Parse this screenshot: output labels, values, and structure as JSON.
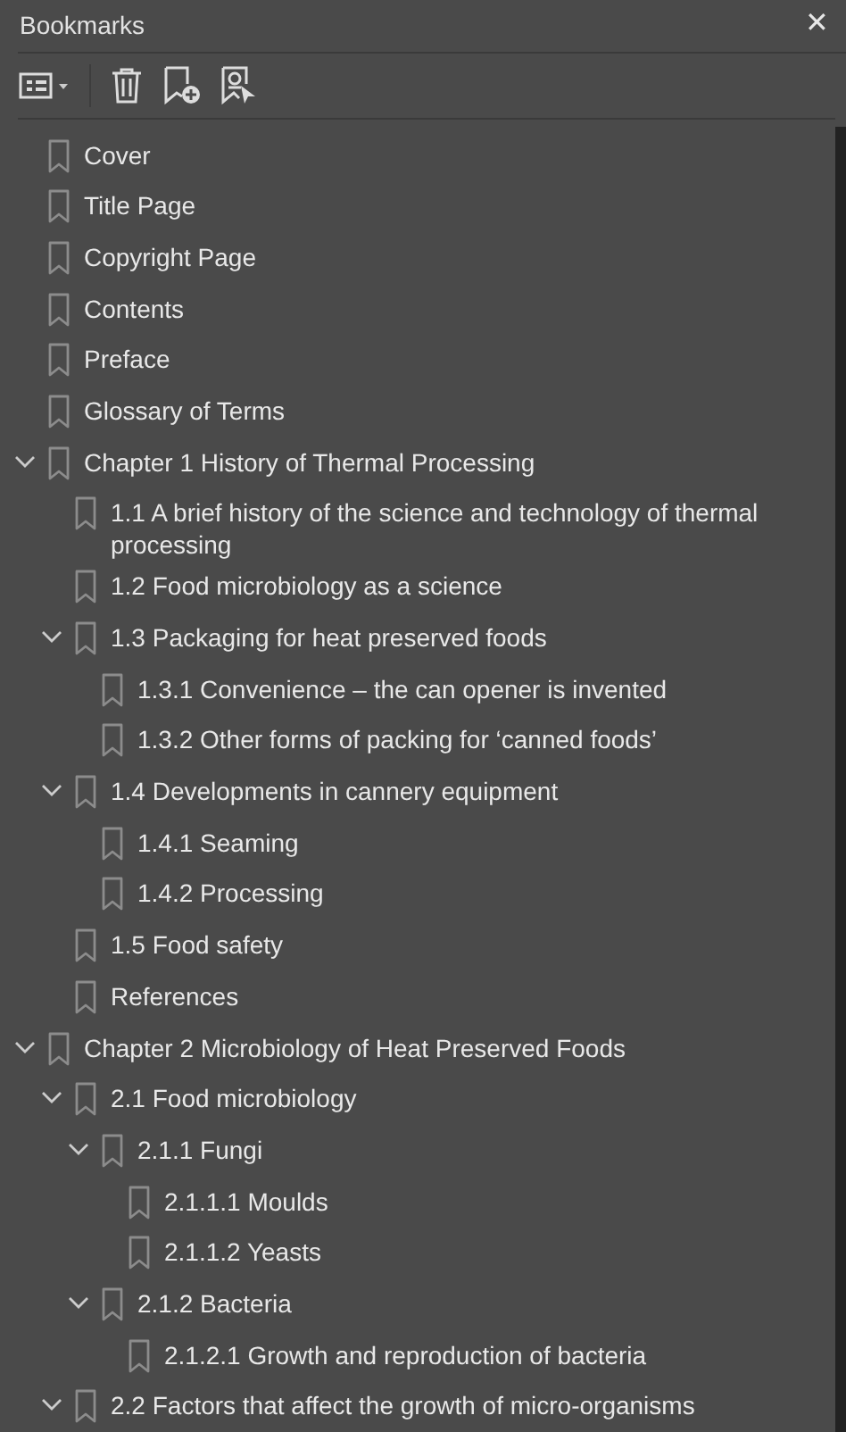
{
  "panel": {
    "title": "Bookmarks",
    "close": "✕"
  },
  "bookmarks": [
    {
      "label": "Cover"
    },
    {
      "label": "Title Page"
    },
    {
      "label": "Copyright Page"
    },
    {
      "label": "Contents"
    },
    {
      "label": "Preface"
    },
    {
      "label": "Glossary of Terms"
    },
    {
      "label": "Chapter 1 History of Thermal Processing",
      "expanded": true,
      "children": [
        {
          "label": "1.1 A brief history of the science and technology of thermal processing"
        },
        {
          "label": "1.2 Food microbiology as a science"
        },
        {
          "label": "1.3 Packaging for heat preserved foods",
          "expanded": true,
          "children": [
            {
              "label": "1.3.1 Convenience – the can opener is invented"
            },
            {
              "label": "1.3.2 Other forms of packing for ‘canned foods’"
            }
          ]
        },
        {
          "label": "1.4 Developments in cannery equipment",
          "expanded": true,
          "children": [
            {
              "label": "1.4.1 Seaming"
            },
            {
              "label": "1.4.2 Processing"
            }
          ]
        },
        {
          "label": "1.5 Food safety"
        },
        {
          "label": "References"
        }
      ]
    },
    {
      "label": "Chapter 2 Microbiology of Heat Preserved Foods",
      "expanded": true,
      "children": [
        {
          "label": "2.1 Food microbiology",
          "expanded": true,
          "children": [
            {
              "label": "2.1.1 Fungi",
              "expanded": true,
              "children": [
                {
                  "label": "2.1.1.1 Moulds"
                },
                {
                  "label": "2.1.1.2 Yeasts"
                }
              ]
            },
            {
              "label": "2.1.2 Bacteria",
              "expanded": true,
              "children": [
                {
                  "label": "2.1.2.1 Growth and reproduction of bacteria"
                }
              ]
            }
          ]
        },
        {
          "label": "2.2 Factors that affect the growth of micro-organisms",
          "expanded": true
        }
      ]
    }
  ]
}
